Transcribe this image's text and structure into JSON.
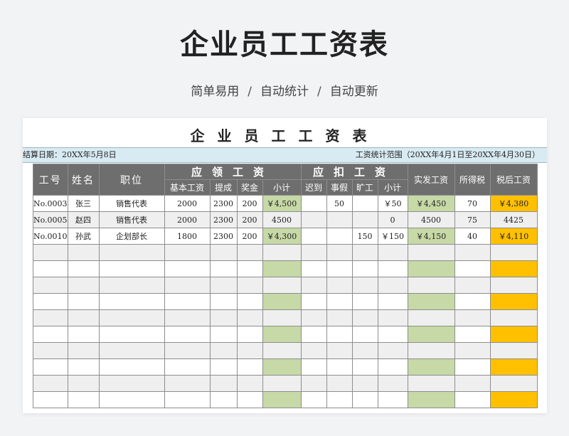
{
  "hero": {
    "title": "企业员工工资表",
    "subtitle": [
      "简单易用",
      "自动统计",
      "自动更新"
    ],
    "separator": "/"
  },
  "sheet": {
    "title": "企业员工工资表",
    "settle_date": "结算日期：20XX年5月8日",
    "range": "工资统计范围（20XX年4月1日至20XX年4月30日）"
  },
  "headers": {
    "id": "工号",
    "name": "姓名",
    "position": "职位",
    "earn_group": "应领工资",
    "deduct_group": "应扣工资",
    "net": "实发工资",
    "tax": "所得税",
    "after_tax": "税后工资",
    "base": "基本工资",
    "commission": "提成",
    "bonus": "奖金",
    "earn_subtotal": "小计",
    "late": "迟到",
    "leave": "事假",
    "absent": "旷工",
    "deduct_subtotal": "小计"
  },
  "rows": [
    {
      "id": "No.0003",
      "name": "张三",
      "position": "销售代表",
      "base": "2000",
      "commission": "2300",
      "bonus": "200",
      "earn_subtotal": "￥4,500",
      "late": "",
      "leave": "50",
      "absent": "",
      "deduct_subtotal": "￥50",
      "net": "￥4,450",
      "tax": "70",
      "after_tax": "￥4,380"
    },
    {
      "id": "No.0005",
      "name": "赵四",
      "position": "销售代表",
      "base": "2000",
      "commission": "2300",
      "bonus": "200",
      "earn_subtotal": "4500",
      "late": "",
      "leave": "",
      "absent": "",
      "deduct_subtotal": "0",
      "net": "4500",
      "tax": "75",
      "after_tax": "4425"
    },
    {
      "id": "No.0010",
      "name": "孙武",
      "position": "企划部长",
      "base": "1800",
      "commission": "2300",
      "bonus": "200",
      "earn_subtotal": "￥4,300",
      "late": "",
      "leave": "",
      "absent": "150",
      "deduct_subtotal": "￥150",
      "net": "￥4,150",
      "tax": "40",
      "after_tax": "￥4,110"
    }
  ],
  "colors": {
    "header_gray": "#6e6e6e",
    "subtotal_green": "#c6d9a6",
    "after_tax_orange": "#ffc000",
    "info_bar_blue": "#d8eaf2"
  }
}
